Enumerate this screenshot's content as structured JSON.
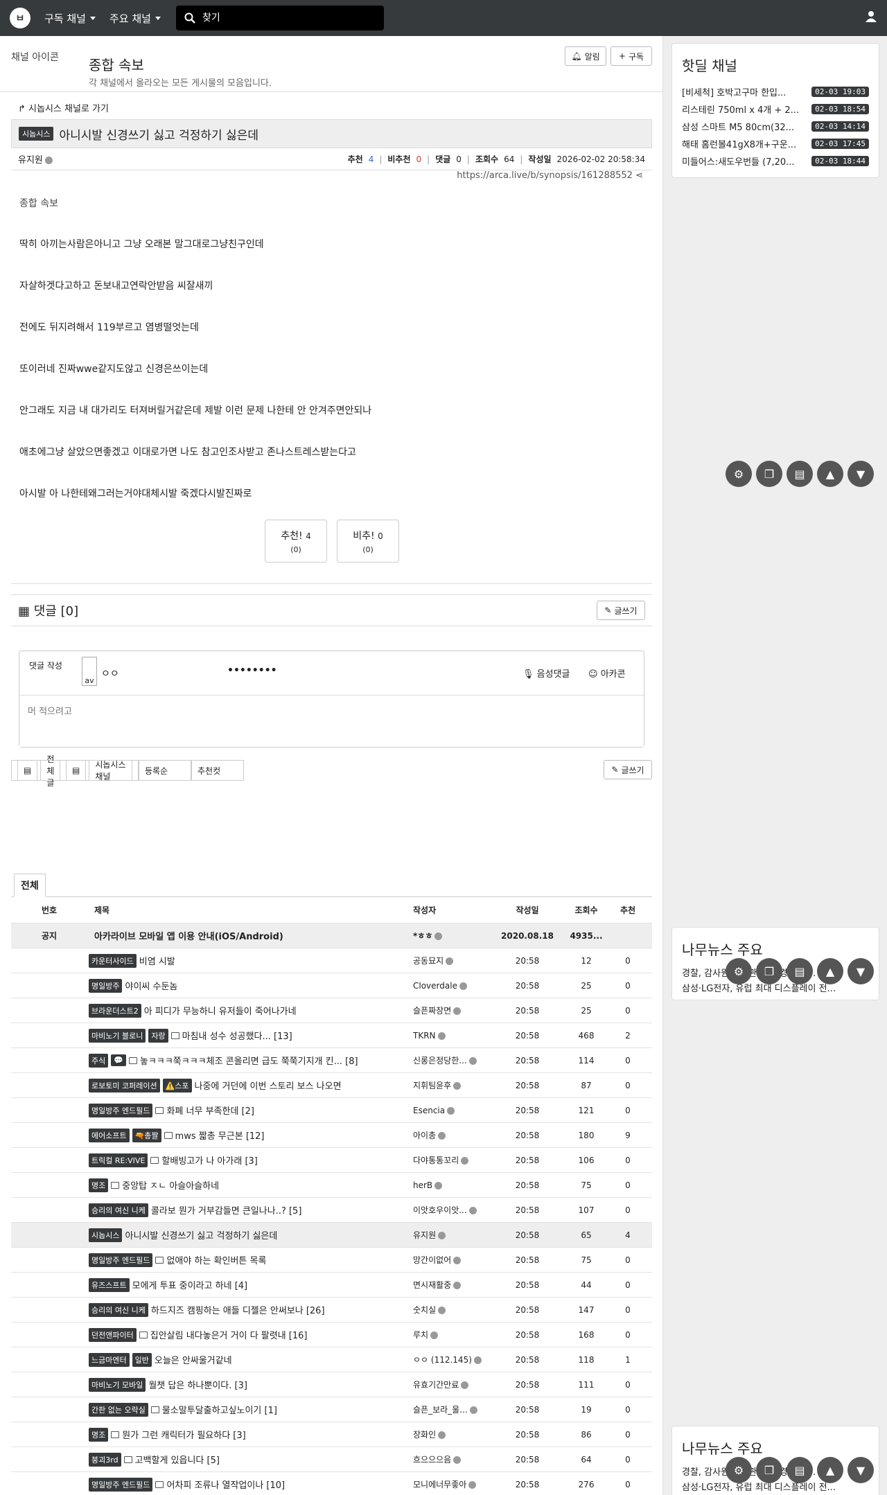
{
  "nav": {
    "subscribed_label": "구독 채널",
    "main_label": "주요 채널",
    "search_placeholder": "찾기"
  },
  "channel": {
    "icon_alt": "채널 아이콘",
    "title": "종합 속보",
    "description": "각 채널에서 올라오는 모든 게시물의 모음입니다.",
    "notify_label": "알림",
    "subscribe_label": "구독"
  },
  "post": {
    "goto_label": "시놉시스 채널로 가기",
    "category": "시놉시스",
    "title": "아니시발 신경쓰기 싫고 걱정하기 싫은데",
    "author": "유지원",
    "rec_label": "추천",
    "rec": "4",
    "unrec_label": "비추천",
    "unrec": "0",
    "comment_label": "댓글",
    "comment": "0",
    "views_label": "조회수",
    "views": "64",
    "date_label": "작성일",
    "date": "2026-02-02 20:58:34",
    "url": "https://arca.live/b/synopsis/161288552",
    "image_alt": "종합 속보",
    "lines": [
      "딱히 아끼는사람은아니고 그냥 오래본 말그대로그냥친구인데",
      "자살하겟다고하고 돈보내고연락안받음 씨잘새끼",
      "전에도 뒤지려해서 119부르고 염병떨엇는데",
      "또이러네 진짜wwe같지도않고 신경은쓰이는데",
      "안그래도 지금 내 대가리도 터져버릴거같은데 제발 이런 문제 나한테 안 안겨주면안되나",
      "애초에그냥 살았으면좋겠고 이대로가면 나도 참고인조사받고 존나스트레스받는다고",
      "아시발 아 나한테왜그러는거야대체시발 죽겠다시발진짜로"
    ],
    "vote_up_label": "추천!",
    "vote_up": "4",
    "vote_up_sub": "(0)",
    "vote_down_label": "비추!",
    "vote_down": "0",
    "vote_down_sub": "(0)"
  },
  "comments": {
    "title": "댓글 [0]",
    "write_label": "글쓰기",
    "form_label": "댓글 작성",
    "avatar_alt": "av",
    "nickname": "ㅇㅇ",
    "password": "••••••••",
    "voice_label": "음성댓글",
    "emoticon_label": "아카콘",
    "placeholder": "머 적으려고"
  },
  "filters": {
    "all": "전체글",
    "channel": "시놉시스 채널",
    "sort": "등록순",
    "recommend": "추천컷",
    "write": "글쓰기"
  },
  "list": {
    "tab": "전체",
    "headers": {
      "no": "번호",
      "title": "제목",
      "author": "작성자",
      "date": "작성일",
      "views": "조회수",
      "rec": "추천"
    },
    "notice": {
      "no": "공지",
      "title": "아카라이브 모바일 앱 이용 안내(iOS/Android)",
      "author": "*ㅎㅎ",
      "date": "2020.08.18",
      "views": "4935...",
      "rec": ""
    },
    "rows": [
      {
        "cat": "카운터사이드",
        "tag": "",
        "img": false,
        "title": "비염 시발",
        "author": "공동묘지",
        "date": "20:58",
        "views": "12",
        "rec": "0"
      },
      {
        "cat": "명일방주",
        "tag": "",
        "img": false,
        "title": "야이씨 수둔놈",
        "author": "Cloverdale",
        "date": "20:58",
        "views": "25",
        "rec": "0"
      },
      {
        "cat": "브라운더스트2",
        "tag": "",
        "img": false,
        "title": "아 피디가 무능하니 유저들이 죽어나가네",
        "author": "슬픈짜장면",
        "date": "20:58",
        "views": "25",
        "rec": "0"
      },
      {
        "cat": "마비노기 블로니",
        "tag": "자랑",
        "img": true,
        "title": "마침내 성수 성공했다... [13]",
        "author": "TKRN",
        "date": "20:58",
        "views": "468",
        "rec": "2"
      },
      {
        "cat": "주식",
        "tag": "💬",
        "img": true,
        "title": "놓ㅋㅋㅋ쭉ㅋㅋㅋ체조 콘올리면 급도 쭉쭉기지개 킨... [8]",
        "author": "신롱은정당한...",
        "date": "20:58",
        "views": "114",
        "rec": "0"
      },
      {
        "cat": "로보토미 코퍼레이션",
        "tag": "⚠️스포",
        "img": false,
        "title": "나중에 거던에 이번 스토리 보스 나오면",
        "author": "지휘팀윤후",
        "date": "20:58",
        "views": "87",
        "rec": "0"
      },
      {
        "cat": "명일방주 엔드필드",
        "tag": "",
        "img": true,
        "title": "화폐 너무 부족한데 [2]",
        "author": "Esencia",
        "date": "20:58",
        "views": "121",
        "rec": "0"
      },
      {
        "cat": "에어소프트",
        "tag": "🔫총짤",
        "img": true,
        "title": "mws 짧총 무근본 [12]",
        "author": "아이총",
        "date": "20:58",
        "views": "180",
        "rec": "9"
      },
      {
        "cat": "트릭컬 RE:VIVE",
        "tag": "",
        "img": true,
        "title": "할배빙고가 나 아가래 [3]",
        "author": "다야통통꼬리",
        "date": "20:58",
        "views": "106",
        "rec": "0"
      },
      {
        "cat": "명조",
        "tag": "",
        "img": true,
        "title": "중앙탑 ㅈㄴ 아슬아슬하네",
        "author": "herB",
        "date": "20:58",
        "views": "75",
        "rec": "0"
      },
      {
        "cat": "승리의 여신 니케",
        "tag": "",
        "img": false,
        "title": "콜라보 뭔가 거부감들면 큰일나나..? [5]",
        "author": "이앗호우이앗...",
        "date": "20:58",
        "views": "107",
        "rec": "0"
      },
      {
        "cat": "시놉시스",
        "tag": "",
        "img": false,
        "title": "아니시발 신경쓰기 싫고 걱정하기 싫은데",
        "author": "유지원",
        "date": "20:58",
        "views": "65",
        "rec": "4",
        "current": true
      },
      {
        "cat": "명일방주 엔드필드",
        "tag": "",
        "img": true,
        "title": "없애야 하는 확인버튼 목록",
        "author": "망간이없어",
        "date": "20:58",
        "views": "75",
        "rec": "0"
      },
      {
        "cat": "유즈스프트",
        "tag": "",
        "img": false,
        "title": "모에게 투표 중이라고 하네 [4]",
        "author": "면시재활중",
        "date": "20:58",
        "views": "44",
        "rec": "0"
      },
      {
        "cat": "승리의 여신 니케",
        "tag": "",
        "img": false,
        "title": "하드지즈 캠핑하는 애들 디젤은 안써보나 [26]",
        "author": "숫치실",
        "date": "20:58",
        "views": "147",
        "rec": "0"
      },
      {
        "cat": "던전앤파이터",
        "tag": "",
        "img": true,
        "title": "집안살림 내다놓은거 거이 다 팔렷내 [16]",
        "author": "루치",
        "date": "20:58",
        "views": "168",
        "rec": "0"
      },
      {
        "cat": "느금마엔터",
        "tag": "일반",
        "img": false,
        "title": "오늘은 안싸울거같네",
        "author": "ㅇㅇ (112.145)",
        "date": "20:58",
        "views": "118",
        "rec": "1"
      },
      {
        "cat": "마비노기 모바일",
        "tag": "",
        "img": false,
        "title": "월챗 답은 하나뿐이다. [3]",
        "author": "유효기간만료",
        "date": "20:58",
        "views": "111",
        "rec": "0"
      },
      {
        "cat": "간판 없는 오락실",
        "tag": "",
        "img": true,
        "title": "물소말투달출하고싶노이기 [1]",
        "author": "슬픈_보라_울...",
        "date": "20:58",
        "views": "19",
        "rec": "0"
      },
      {
        "cat": "명조",
        "tag": "",
        "img": true,
        "title": "뭔가 그런 캐릭터가 필요하다 [3]",
        "author": "장화인",
        "date": "20:58",
        "views": "86",
        "rec": "0"
      },
      {
        "cat": "붕괴3rd",
        "tag": "",
        "img": true,
        "title": "고백할게 있읍니다 [5]",
        "author": "흐으으으음",
        "date": "20:58",
        "views": "64",
        "rec": "0"
      },
      {
        "cat": "명일방주 엔드필드",
        "tag": "",
        "img": true,
        "title": "어차피 조류나 열작업이나 [10]",
        "author": "모니에너무좋아",
        "date": "20:58",
        "views": "276",
        "rec": "0"
      }
    ]
  },
  "sidebar": {
    "hotdeal_title": "핫딜 채널",
    "hotdeals": [
      {
        "title": "[비세척] 호박고구마 한입...",
        "date": "02-03 19:03"
      },
      {
        "title": "리스테린 750ml x 4개 + 2...",
        "date": "02-03 18:54"
      },
      {
        "title": "삼성 스마트 M5 80cm(32...",
        "date": "02-03 14:14"
      },
      {
        "title": "해태 홈런볼41gX8개+구운...",
        "date": "02-03 17:45"
      },
      {
        "title": "미들어스:새도우번들 (7,20...",
        "date": "02-03 18:44"
      }
    ],
    "news_title": "나무뉴스 주요",
    "news_lines": [
      "경찰, 감사원 수사관 ... 국경 교계...",
      "삼성·LG전자, 유럽 최대 디스플레이 전..."
    ]
  }
}
